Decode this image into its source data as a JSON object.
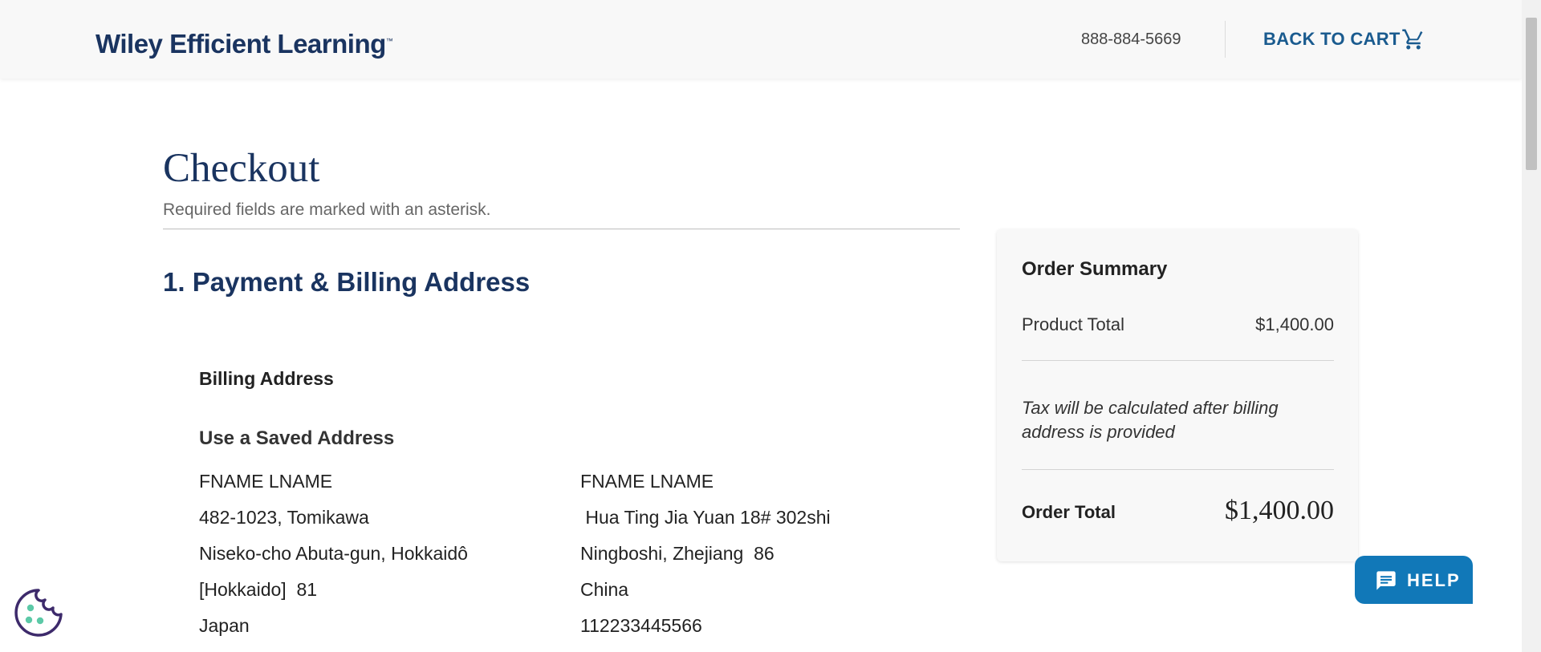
{
  "header": {
    "logo_text": "Wiley Efficient Learning",
    "logo_tm": "™",
    "phone": "888-884-5669",
    "back_to_cart": "BACK TO CART",
    "cart_icon": "cart-icon"
  },
  "main": {
    "title": "Checkout",
    "required_note": "Required fields are marked with an asterisk.",
    "section_title": "1. Payment & Billing Address",
    "billing_label": "Billing Address",
    "saved_label": "Use a Saved Address",
    "addresses": [
      {
        "lines": [
          "FNAME LNAME",
          "482-1023, Tomikawa",
          "Niseko-cho Abuta-gun, Hokkaidô",
          "[Hokkaido]  81",
          "Japan"
        ]
      },
      {
        "lines": [
          "FNAME LNAME",
          " Hua Ting Jia Yuan 18# 302shi",
          "Ningboshi, Zhejiang  86",
          "China",
          "112233445566"
        ]
      }
    ]
  },
  "summary": {
    "title": "Order Summary",
    "product_total_label": "Product Total",
    "product_total_value": "$1,400.00",
    "tax_note": "Tax will be calculated after billing address is provided",
    "order_total_label": "Order Total",
    "order_total_value": "$1,400.00"
  },
  "help": {
    "label": "HELP",
    "icon": "chat-icon"
  },
  "cookie": {
    "icon": "cookie-icon"
  },
  "colors": {
    "brand_navy": "#1a3460",
    "link_blue": "#1a5b8f",
    "help_blue": "#1178b8",
    "cookie_purple": "#3d2a6b",
    "cookie_teal": "#5cc9a7"
  }
}
